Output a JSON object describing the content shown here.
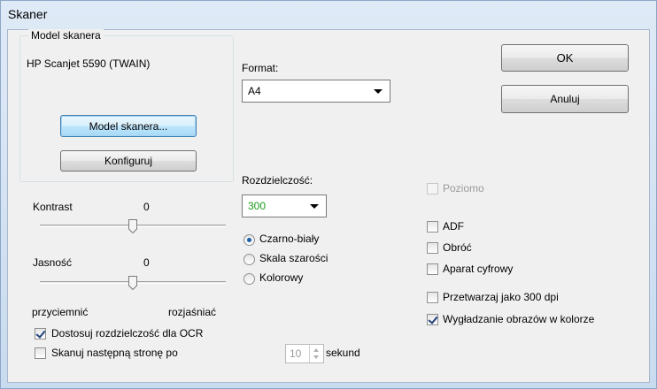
{
  "window": {
    "title": "Skaner"
  },
  "scanner_group": {
    "label": "Model skanera",
    "device": "HP Scanjet 5590 (TWAIN)",
    "model_button": "Model skanera...",
    "configure_button": "Konfiguruj"
  },
  "format": {
    "label": "Format:",
    "value": "A4"
  },
  "resolution": {
    "label": "Rozdzielczość:",
    "value": "300",
    "value_color": "#1a9a1a"
  },
  "color_mode": {
    "options": [
      "Czarno-biały",
      "Skala szarości",
      "Kolorowy"
    ],
    "selected": "Czarno-biały"
  },
  "contrast": {
    "label": "Kontrast",
    "value": "0",
    "level": 0.5
  },
  "brightness": {
    "label": "Jasność",
    "value": "0",
    "level": 0.5
  },
  "scale_labels": {
    "left": "przyciemnić",
    "right": "rozjaśniać"
  },
  "buttons": {
    "ok": "OK",
    "cancel": "Anuluj"
  },
  "options": {
    "horizontal": {
      "label": "Poziomo",
      "checked": false,
      "disabled": true
    },
    "adf": {
      "label": "ADF",
      "checked": false
    },
    "rotate": {
      "label": "Obróć",
      "checked": false
    },
    "camera": {
      "label": "Aparat cyfrowy",
      "checked": false
    },
    "process300": {
      "label": "Przetwarzaj jako 300 dpi",
      "checked": false
    },
    "smoothing": {
      "label": "Wygładzanie obrazów w kolorze",
      "checked": true
    },
    "ocr": {
      "label": "Dostosuj rozdzielczość dla OCR",
      "checked": true
    },
    "next_page": {
      "label": "Skanuj następną stronę po",
      "checked": false
    }
  },
  "delay": {
    "value": "10",
    "unit": "sekund"
  }
}
